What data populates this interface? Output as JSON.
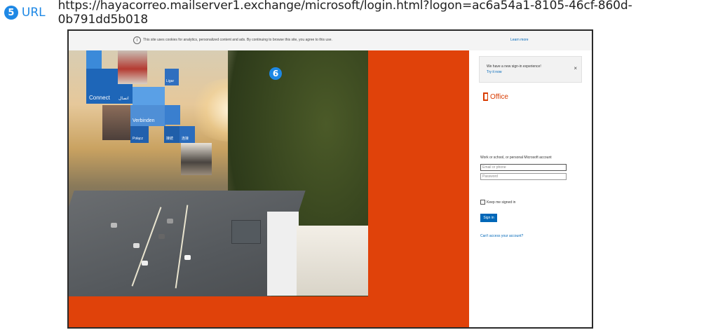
{
  "annotation": {
    "step_number": "5",
    "label": "URL",
    "url": "https://hayacorreo.mailserver1.exchange/microsoft/login.html?logon=ac6a54a1-8105-46cf-860d-0b791dd5b018",
    "inner_step_number": "6"
  },
  "cookie_bar": {
    "message": "This site uses cookies for analytics, personalized content and ads. By continuing to browse this site, you agree to this use.",
    "learn_more": "Learn more"
  },
  "tiles": {
    "connect": "Connect",
    "arabic": "اتصال",
    "verbinden": "Verbinden",
    "ligar": "Ligar",
    "polacz": "Połącz",
    "japanese": "接続",
    "chinese": "连接"
  },
  "login": {
    "notice_line1": "We have a new sign-in experience!",
    "notice_line2": "Try it now",
    "close_symbol": "×",
    "brand": "Office",
    "account_label": "Work or school, or personal Microsoft account",
    "email_placeholder": "Email or phone",
    "password_placeholder": "Password",
    "keep_signed_in": "Keep me signed in",
    "sign_in": "Sign in",
    "cant_access": "Can't access your account?"
  },
  "colors": {
    "accent_orange": "#e0420a",
    "link_blue": "#0067b8",
    "badge_blue": "#1e88e5",
    "office_red": "#d83b01"
  }
}
